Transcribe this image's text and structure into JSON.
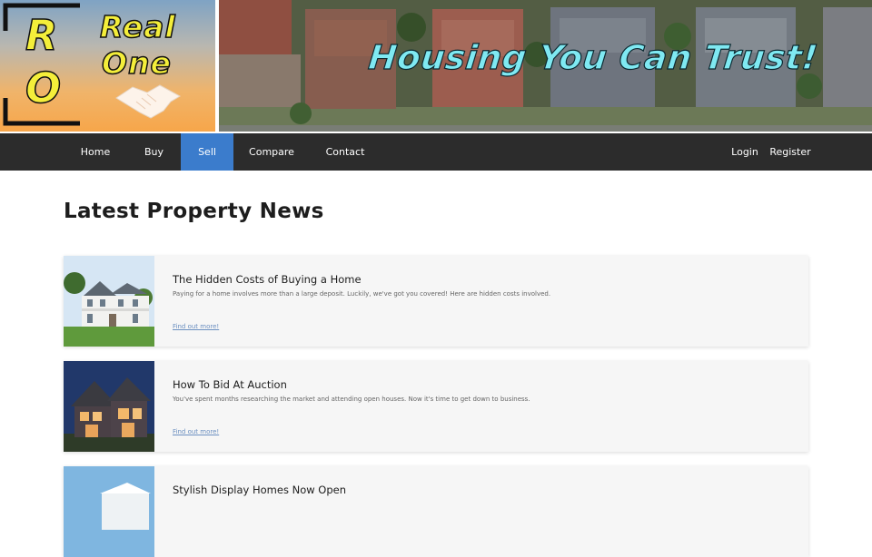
{
  "logo": {
    "letter_r": "R",
    "letter_o": "O",
    "word_real": "Real",
    "word_one": "One"
  },
  "banner": {
    "tagline": "Housing You Can Trust!"
  },
  "nav": {
    "items": [
      {
        "label": "Home"
      },
      {
        "label": "Buy"
      },
      {
        "label": "Sell",
        "active": true
      },
      {
        "label": "Compare"
      },
      {
        "label": "Contact"
      }
    ],
    "login": "Login",
    "register": "Register",
    "active_color": "#3b7ccc",
    "bar_color": "#2c2c2c"
  },
  "main": {
    "title": "Latest Property News",
    "articles": [
      {
        "title": "The Hidden Costs of Buying a Home",
        "description": "Paying for a home involves more than a large deposit. Luckily, we've got you covered! Here are hidden costs involved.",
        "link": "Find out more!",
        "image": "white-house-photo"
      },
      {
        "title": "How To Bid At Auction",
        "description": "You've spent months researching the market and attending open houses. Now it's time to get down to business.",
        "link": "Find out more!",
        "image": "house-at-dusk-photo"
      },
      {
        "title": "Stylish Display Homes Now Open",
        "description": "",
        "link": "",
        "image": "display-home-photo"
      }
    ]
  }
}
